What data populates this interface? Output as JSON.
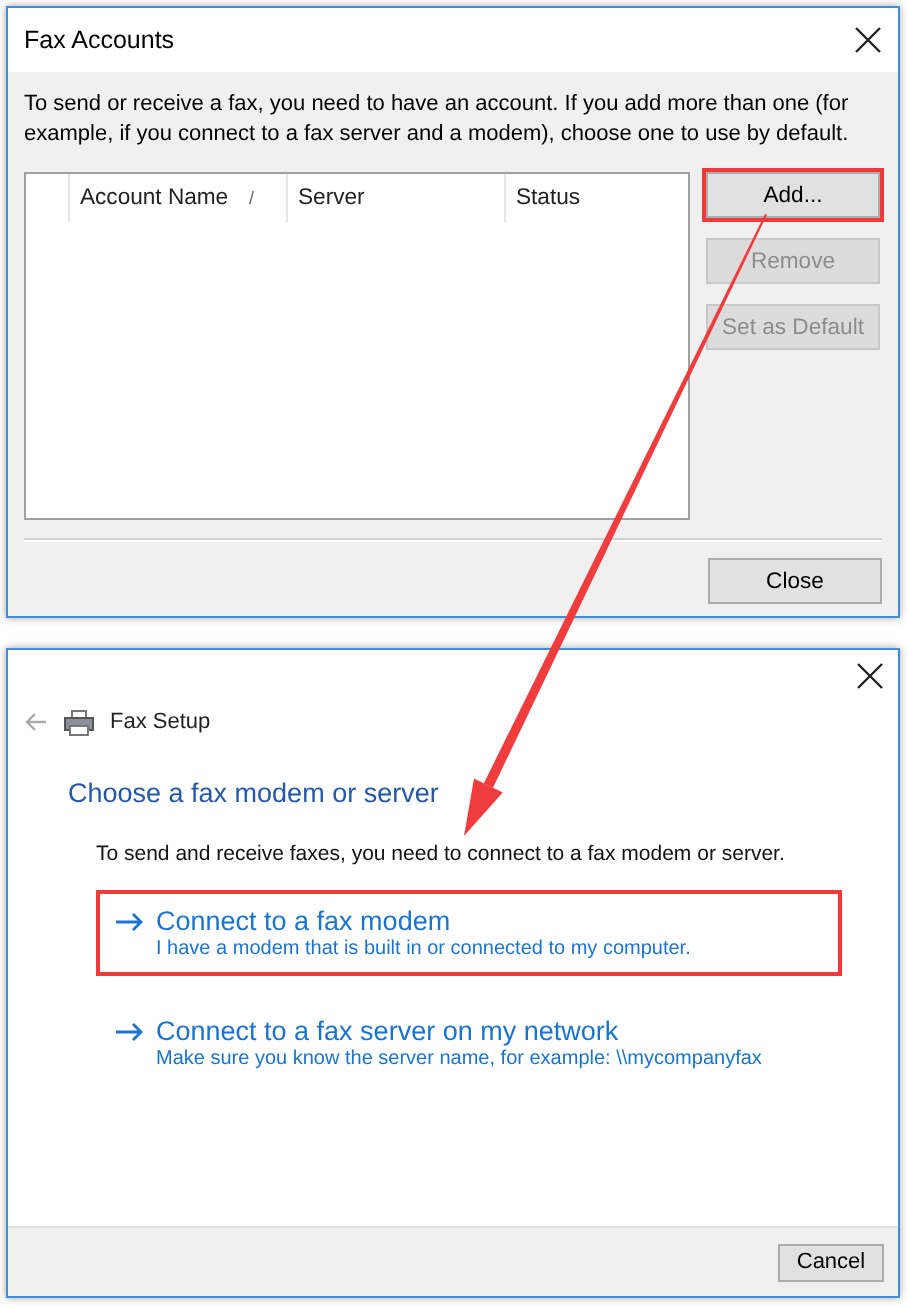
{
  "fax_accounts_window": {
    "title": "Fax Accounts",
    "intro": "To send or receive a fax, you need to have an account. If you add more than one (for example, if you connect to a fax server and a modem), choose one to use by default.",
    "table": {
      "columns": [
        {
          "label": "Account Name",
          "sort_mark": "/"
        },
        {
          "label": "Server"
        },
        {
          "label": "Status"
        }
      ]
    },
    "buttons": [
      {
        "label": "Add...",
        "disabled": false,
        "highlighted": true
      },
      {
        "label": "Remove",
        "disabled": true,
        "highlighted": false
      },
      {
        "label": "Set as Default",
        "disabled": true,
        "highlighted": false
      }
    ],
    "close_button": "Close"
  },
  "fax_setup_window": {
    "title": "Fax Setup",
    "heading": "Choose a fax modem or server",
    "description": "To send and receive faxes, you need to connect to a fax modem or server.",
    "options": [
      {
        "title": "Connect to a fax modem",
        "subtitle": "I have a modem that is built in or connected to my computer.",
        "highlighted": true
      },
      {
        "title": "Connect to a fax server on my network",
        "subtitle": "Make sure you know the server name, for example: \\\\mycompanyfax",
        "highlighted": false
      }
    ],
    "cancel_button": "Cancel"
  }
}
